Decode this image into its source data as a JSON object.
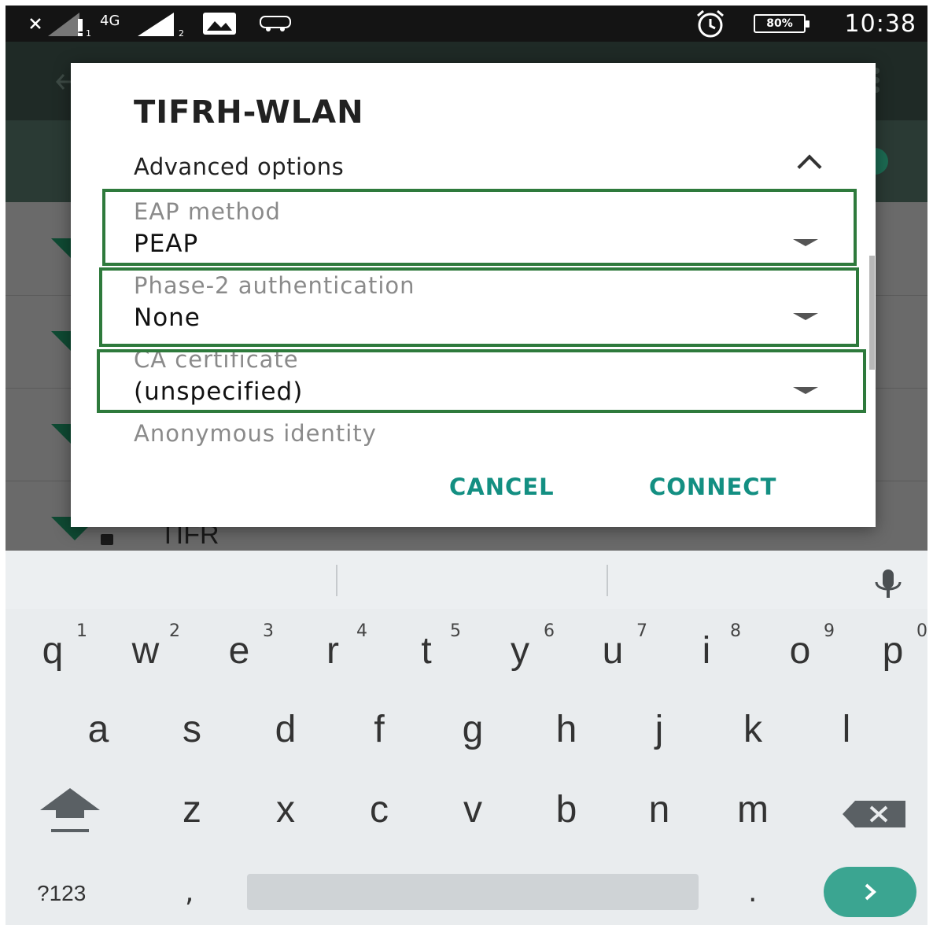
{
  "status_bar": {
    "network_label": "4G",
    "battery": "80%",
    "time": "10:38"
  },
  "background": {
    "network_name": "TIFR"
  },
  "dialog": {
    "title": "TIFRH-WLAN",
    "advanced_options_label": "Advanced options",
    "fields": [
      {
        "label": "EAP method",
        "value": "PEAP"
      },
      {
        "label": "Phase-2 authentication",
        "value": "None"
      },
      {
        "label": "CA certificate",
        "value": "(unspecified)"
      },
      {
        "label": "Anonymous identity",
        "value": ""
      }
    ],
    "cancel_label": "CANCEL",
    "connect_label": "CONNECT",
    "accent_color": "#138f82",
    "highlight_color": "#2e7a3c"
  },
  "keyboard": {
    "row1": [
      {
        "letter": "q",
        "num": "1"
      },
      {
        "letter": "w",
        "num": "2"
      },
      {
        "letter": "e",
        "num": "3"
      },
      {
        "letter": "r",
        "num": "4"
      },
      {
        "letter": "t",
        "num": "5"
      },
      {
        "letter": "y",
        "num": "6"
      },
      {
        "letter": "u",
        "num": "7"
      },
      {
        "letter": "i",
        "num": "8"
      },
      {
        "letter": "o",
        "num": "9"
      },
      {
        "letter": "p",
        "num": "0"
      }
    ],
    "row2": [
      "a",
      "s",
      "d",
      "f",
      "g",
      "h",
      "j",
      "k",
      "l"
    ],
    "row3": [
      "z",
      "x",
      "c",
      "v",
      "b",
      "n",
      "m"
    ],
    "symbols_label": "?123",
    "comma": ",",
    "period": ".",
    "go_color": "#3ba591"
  }
}
